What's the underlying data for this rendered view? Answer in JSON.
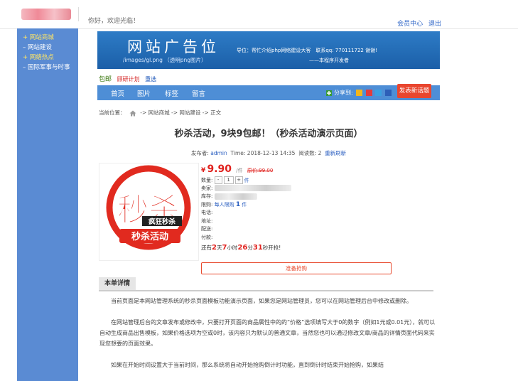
{
  "topbar": {
    "welcome": "你好，欢迎光临！",
    "member_center": "会员中心",
    "logout": "退出"
  },
  "sidebar": {
    "items": [
      {
        "label": "+ 网站商城",
        "color": "yellow"
      },
      {
        "label": "– 网站建设",
        "color": "white"
      },
      {
        "label": "+ 网络热点",
        "color": "yellow"
      },
      {
        "label": "– 国际军事与时事",
        "color": "white"
      }
    ]
  },
  "banner": {
    "title": "网站广告位",
    "path": "/images/gl.png （透明png图片）",
    "info": "导位：帮忙介绍php网络建设大客　联系qq: 770111722 谢谢!",
    "sub": "——本程序开发者"
  },
  "ad_links": {
    "a": "包邮",
    "b": "顾研计划",
    "c": "重选"
  },
  "nav": {
    "items": [
      "首页",
      "图片",
      "标签",
      "留言"
    ],
    "share_label": "分享到:",
    "post_button": "发表新话题"
  },
  "breadcrumb": {
    "prefix": "当前位置：",
    "path": "-> 网站商城 -> 网站建设 -> 正文"
  },
  "article": {
    "title": "秒杀活动，9块9包邮！（秒杀活动演示页面）",
    "author_label": "发布者:",
    "author": "admin",
    "time": "Time: 2018-12-13 14:35",
    "reads": "阅读数: 2",
    "refresh": "重新刷新"
  },
  "promo": {
    "big": "秒杀",
    "badge": "疯狂秒杀",
    "bottom": "秒杀活动"
  },
  "product": {
    "currency": "¥",
    "price": "9.90",
    "unit": "/件",
    "orig_label": "原价:",
    "orig_price": "99.00",
    "qty_label": "数量:",
    "qty_minus": "-",
    "qty_value": "1",
    "qty_plus": "+",
    "qty_unit": "件",
    "seller_label": "卖家:",
    "stock_label": "库存:",
    "limit_label": "限购:",
    "limit_text": "每人限购",
    "limit_num": "1",
    "limit_unit": "件",
    "phone_label": "电话:",
    "address_label": "地址:",
    "delivery_label": "配送:",
    "payment_label": "付款:",
    "countdown": {
      "prefix": "还有",
      "days": "2",
      "days_unit": "天",
      "hours": "7",
      "hours_unit": "小时",
      "minutes": "26",
      "minutes_unit": "分",
      "seconds": "31",
      "seconds_unit": "秒开抢!"
    },
    "buy_button": "准备抢购"
  },
  "details": {
    "tab": "本单详情",
    "paragraphs": [
      "当前页面是本网站管理系统的秒杀页面模板功能演示页面，如果您是网站管理员，您可以在网站管理后台中修改或删除。",
      "在网站管理后台的文章发布或修改中，只要打开页面的商品属性中的的“价格”选项填写大于0的数字（例如1元或0.01元），就可以自动生成商品出售模板，如果价格选项为空或0时，该内容只为默认的普通文章，当然您也可以通过修改文章/商品的详情页面代码来实现您想要的页面效果。",
      "如果在开始时间设置大于当前时间，那么系统将自动开始抢购倒计时功能，直到倒计时结束开始抢购，如果结"
    ]
  },
  "colors": {
    "sidebar": "#5a8bd3",
    "nav": "#4e8ed6",
    "accent_red": "#e0211d",
    "post_button": "#e9462f"
  }
}
